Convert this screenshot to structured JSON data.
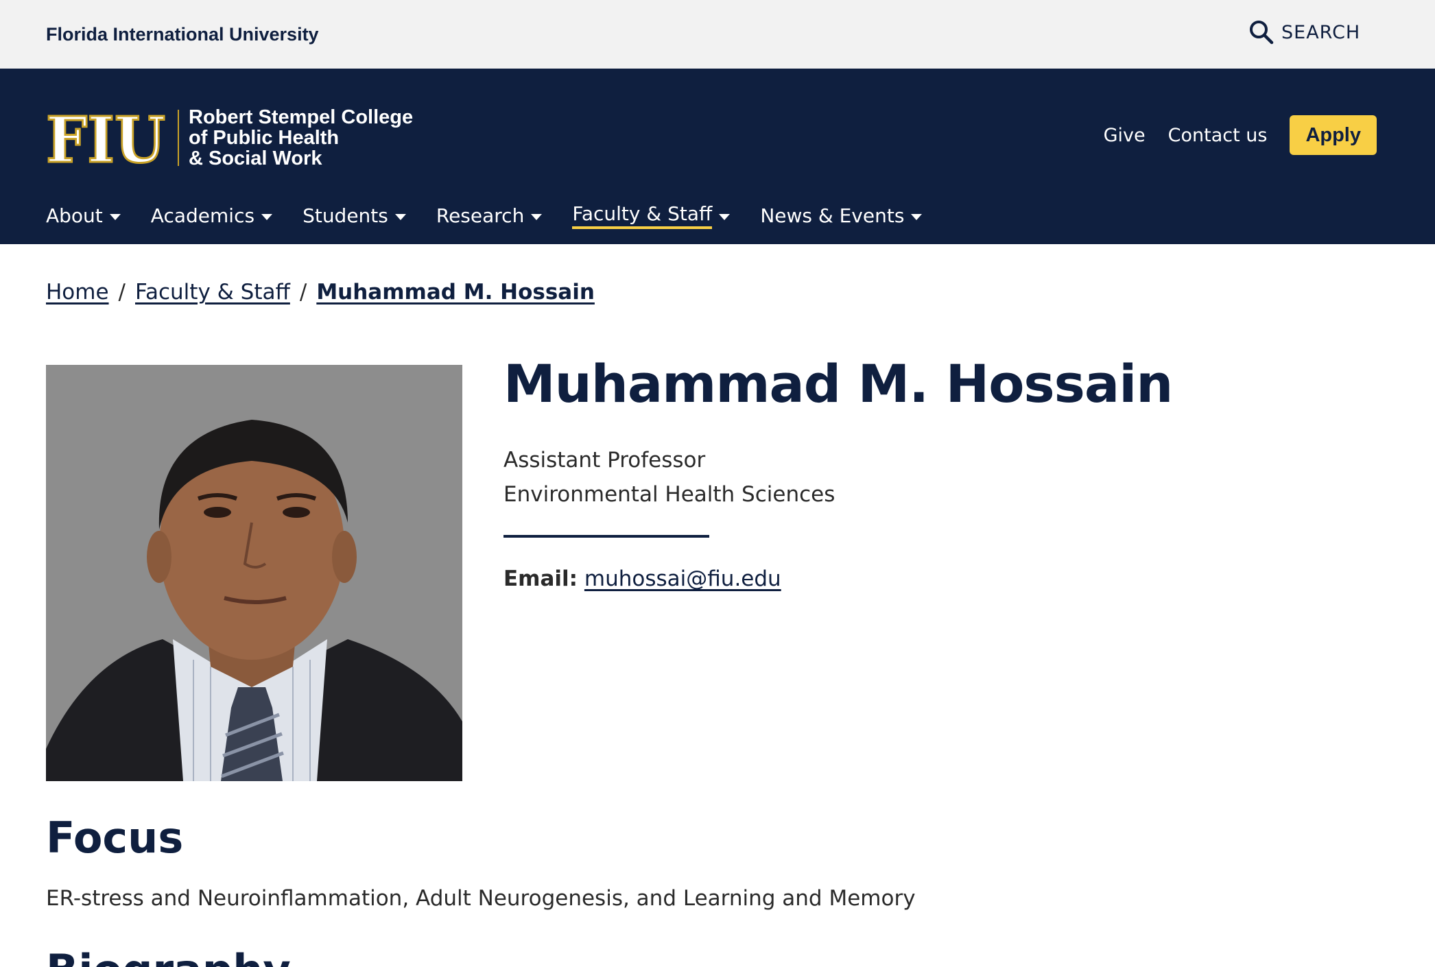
{
  "utility": {
    "university": "Florida International University",
    "search_label": "SEARCH"
  },
  "header": {
    "logo_mark": "FIU",
    "college_lines": [
      "Robert Stempel College",
      "of Public Health",
      "& Social Work"
    ],
    "links": [
      "Give",
      "Contact us"
    ],
    "apply_label": "Apply"
  },
  "nav": {
    "items": [
      "About",
      "Academics",
      "Students",
      "Research",
      "Faculty & Staff",
      "News & Events"
    ],
    "active": "Faculty & Staff"
  },
  "breadcrumb": {
    "home": "Home",
    "section": "Faculty & Staff",
    "current": "Muhammad M. Hossain"
  },
  "profile": {
    "name": "Muhammad M. Hossain",
    "title": "Assistant Professor",
    "department": "Environmental Health Sciences",
    "email_label": "Email:",
    "email": "muhossai@fiu.edu"
  },
  "focus": {
    "heading": "Focus",
    "text": "ER-stress and Neuroinflammation, Adult Neurogenesis, and Learning and Memory"
  },
  "biography": {
    "heading": "Biography"
  },
  "colors": {
    "navy": "#0f1f3f",
    "gold": "#f8cf45",
    "utility_bg": "#f2f2f2"
  }
}
